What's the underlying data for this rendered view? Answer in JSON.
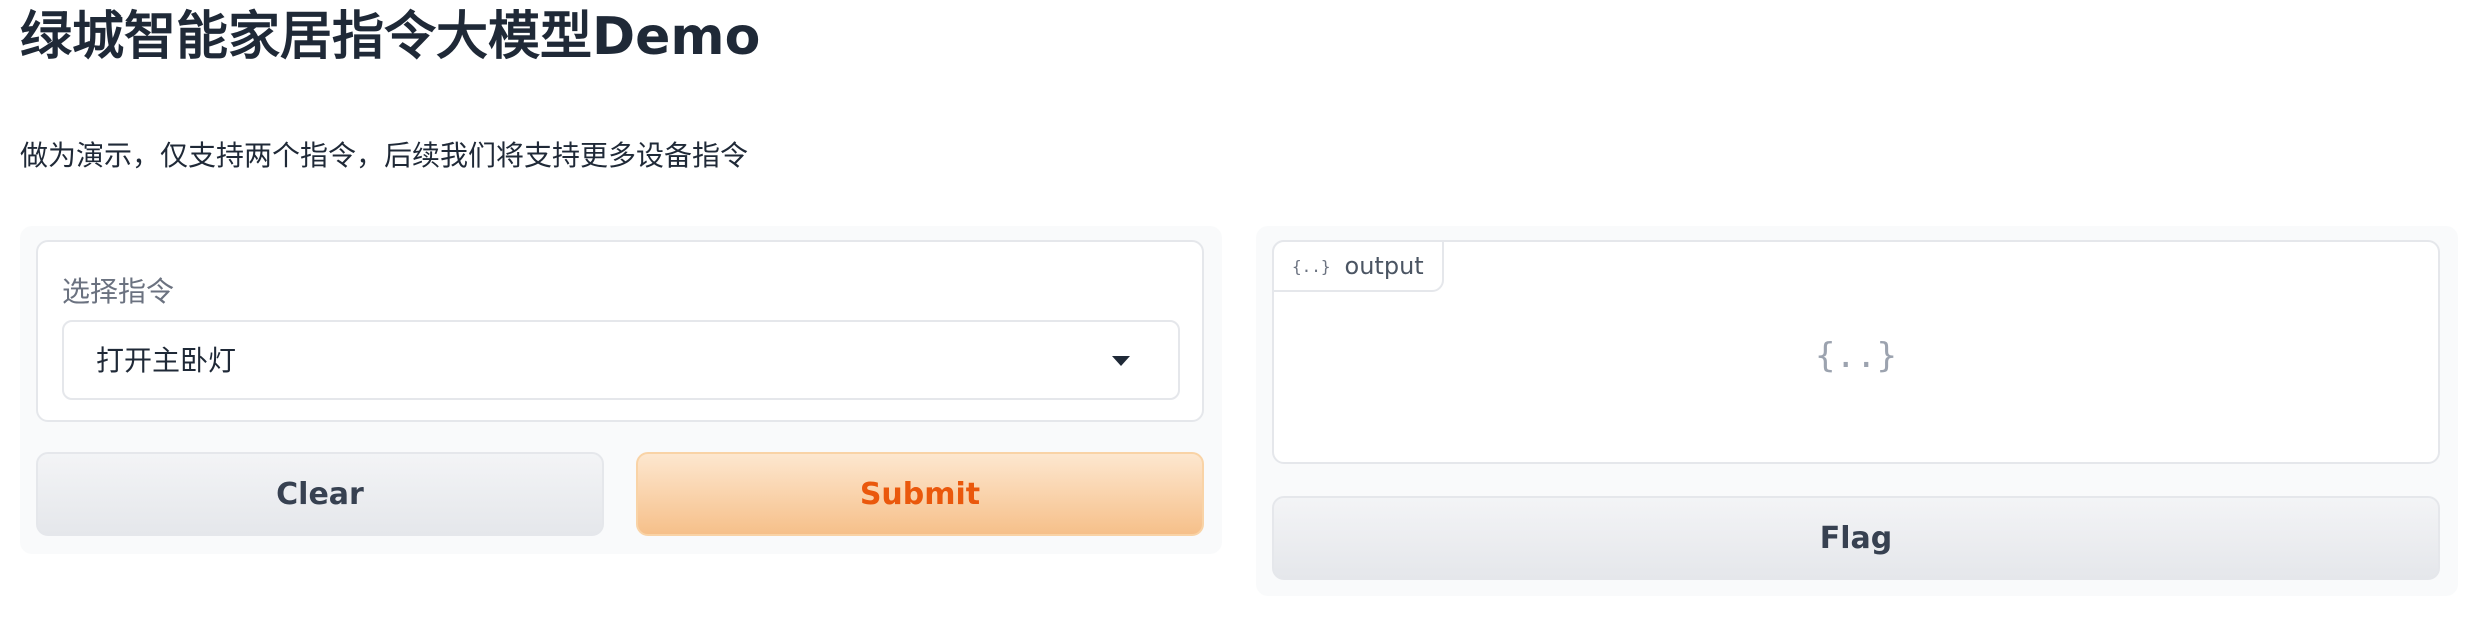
{
  "header": {
    "title": "绿城智能家居指令大模型Demo",
    "description": "做为演示，仅支持两个指令，后续我们将支持更多设备指令"
  },
  "input_panel": {
    "dropdown_label": "选择指令",
    "dropdown_selected": "打开主卧灯",
    "clear_label": "Clear",
    "submit_label": "Submit"
  },
  "output_panel": {
    "tab_icon": "{..}",
    "tab_label": "output",
    "empty_icon": "{..}",
    "flag_label": "Flag"
  },
  "colors": {
    "accent": "#ea580c",
    "submit_gradient_top": "#fde7cf",
    "submit_gradient_bottom": "#f6c08a"
  }
}
